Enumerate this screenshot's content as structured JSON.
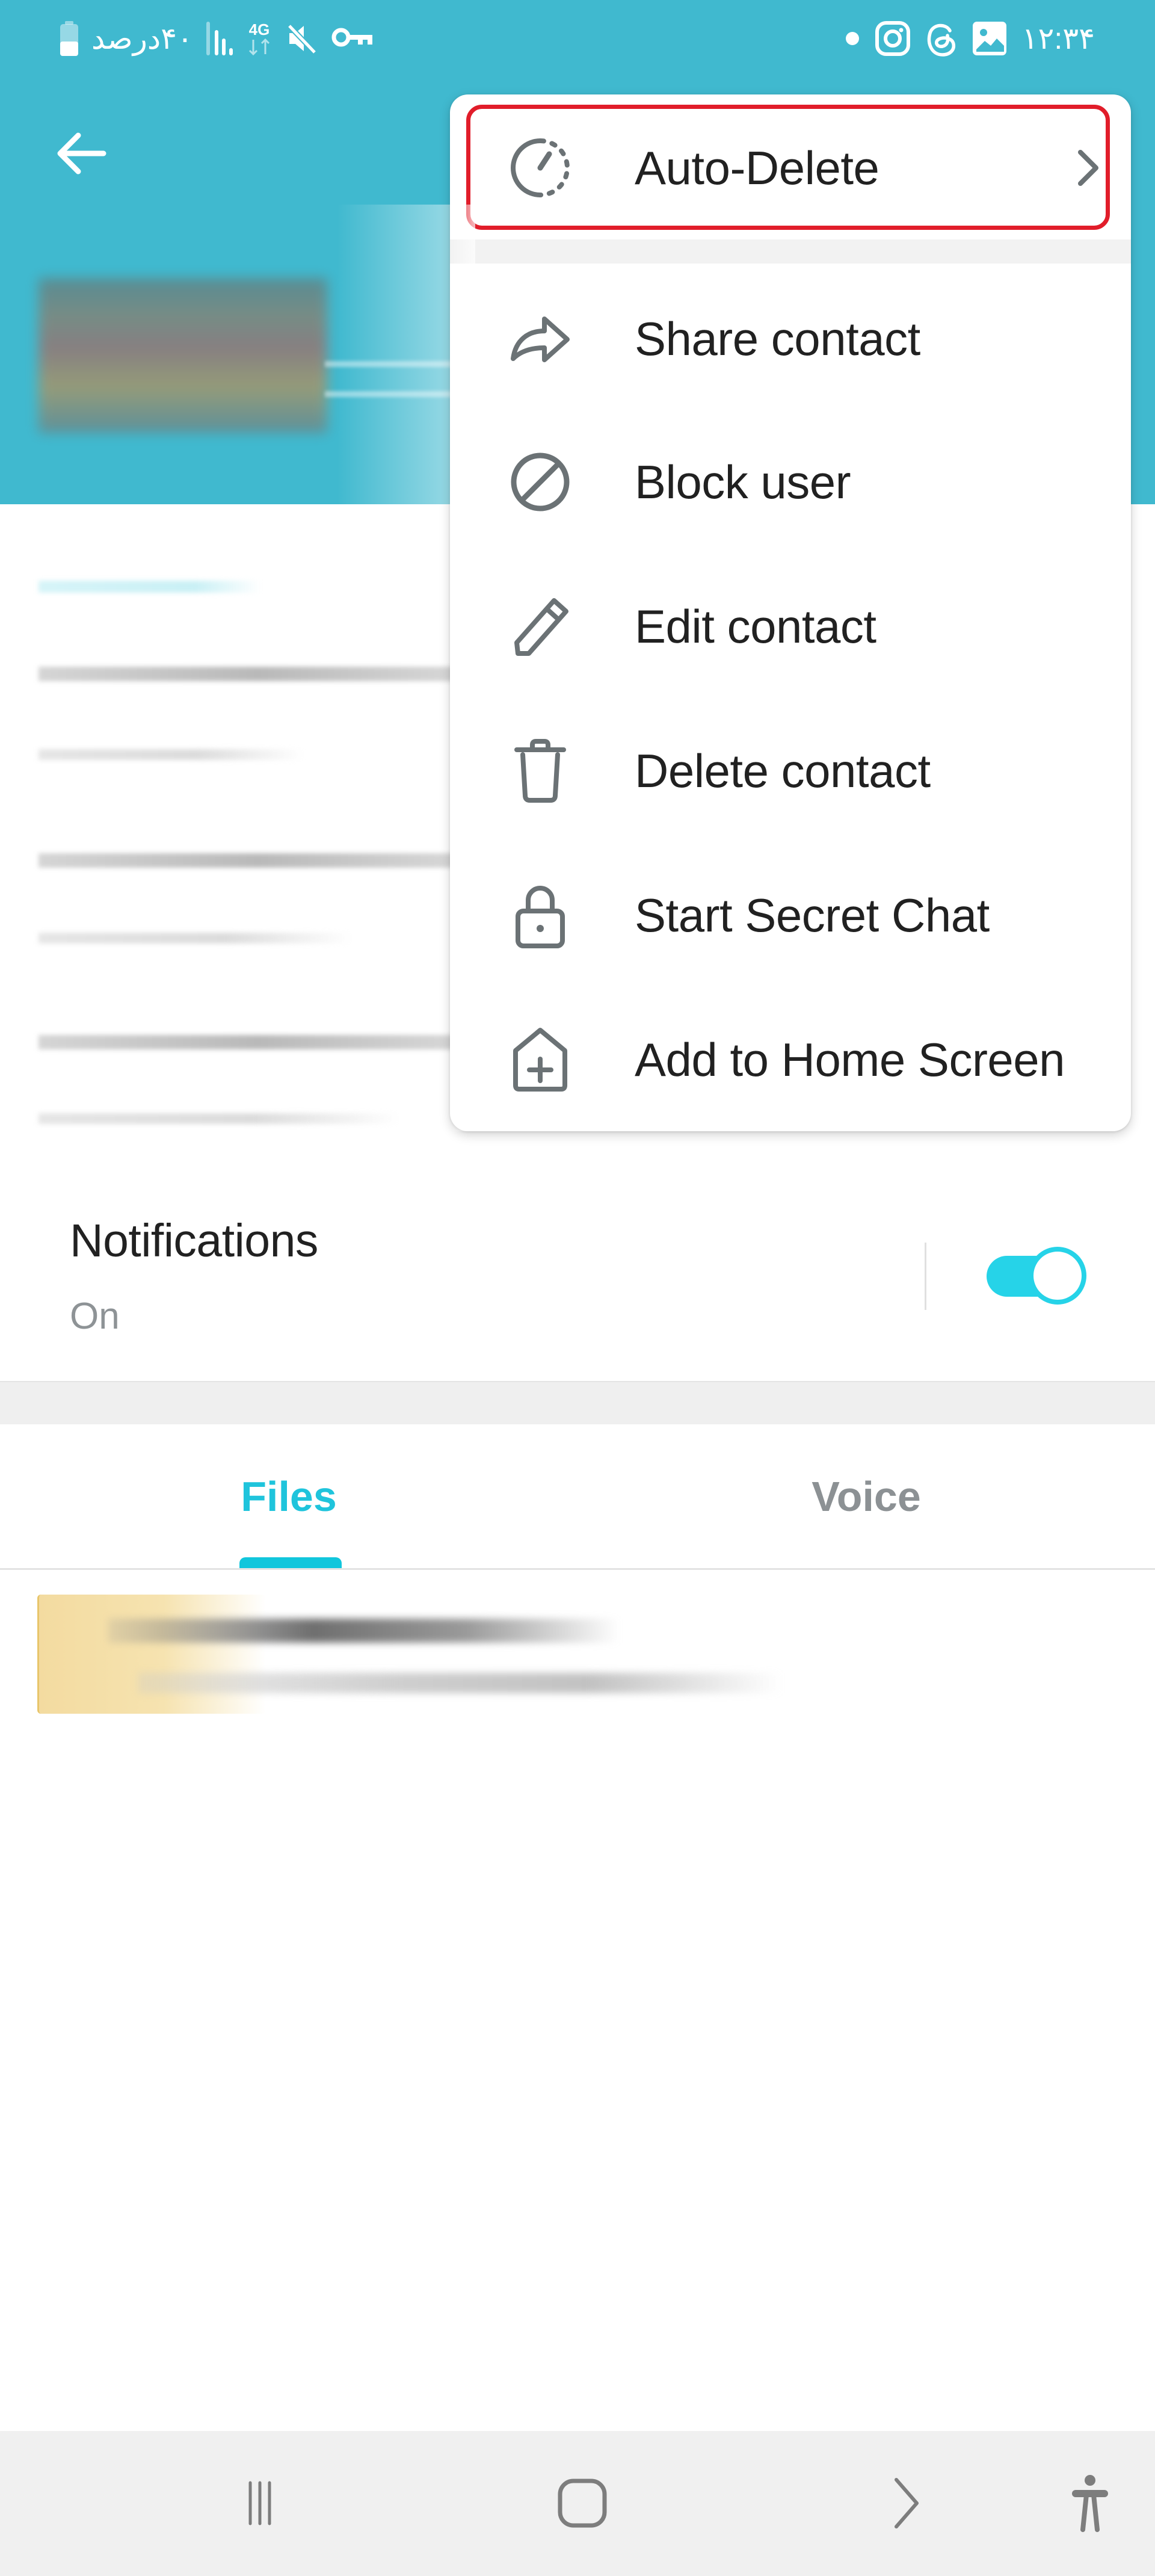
{
  "status_bar": {
    "time": "۱۲:۳۴",
    "battery_text": "۴۰درصد",
    "network_type": "4G",
    "left_icons": [
      "battery-icon",
      "signal-icon",
      "4g-data-icon",
      "mute-icon",
      "vpn-key-icon"
    ],
    "right_icons": [
      "notification-dot-icon",
      "instagram-icon",
      "threads-icon",
      "gallery-icon"
    ]
  },
  "header": {
    "back_icon": "arrow-left-icon",
    "profile_name": "[redacted]",
    "profile_status": "[redacted]"
  },
  "menu": {
    "items": [
      {
        "label": "Auto-Delete",
        "icon": "timer-icon",
        "has_submenu": true,
        "highlighted": true
      },
      {
        "label": "Share contact",
        "icon": "share-icon"
      },
      {
        "label": "Block user",
        "icon": "block-icon"
      },
      {
        "label": "Edit contact",
        "icon": "pencil-icon"
      },
      {
        "label": "Delete contact",
        "icon": "trash-icon"
      },
      {
        "label": "Start Secret Chat",
        "icon": "lock-icon"
      },
      {
        "label": "Add to Home Screen",
        "icon": "add-home-icon"
      }
    ]
  },
  "notifications": {
    "title": "Notifications",
    "status": "On",
    "enabled": true
  },
  "tabs": {
    "items": [
      {
        "label": "Files",
        "active": true
      },
      {
        "label": "Voice",
        "active": false
      }
    ]
  },
  "files": {
    "items": [
      {
        "name": "[redacted]",
        "details": "[redacted]"
      }
    ]
  },
  "colors": {
    "header": "#40b9cf",
    "accent": "#1fc4dc",
    "toggle": "#26d3e8",
    "highlight_box": "#e11d2a",
    "icon_gray": "#6b7275"
  },
  "nav_bar": {
    "buttons": [
      "recent-apps",
      "home",
      "back",
      "accessibility"
    ]
  }
}
